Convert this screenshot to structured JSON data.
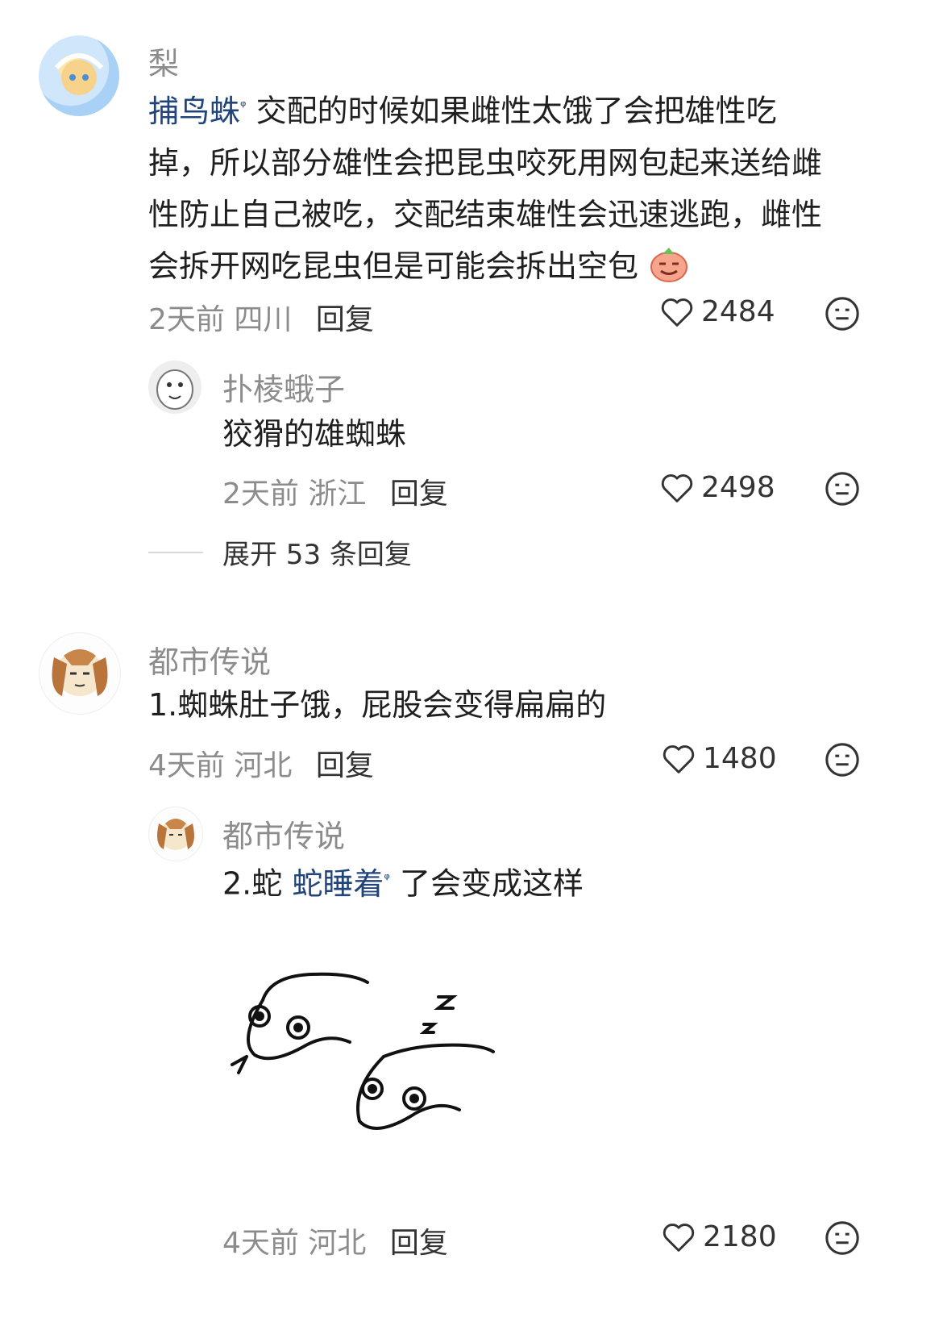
{
  "comments": [
    {
      "username": "梨",
      "link_text": "捕鸟蛛",
      "text_parts": [
        "交配的时候如果雌性太饿了会把雄性吃",
        "掉，所以部分雄性会把昆虫咬死用网包起来送给雌",
        "性防止自己被吃，交配结束雄性会迅速逃跑，雌性",
        "会拆开网吃昆虫但是可能会拆出空包"
      ],
      "time": "2天前",
      "location": "四川",
      "reply_label": "回复",
      "likes": "2484"
    },
    {
      "username": "扑棱蛾子",
      "text": "狡猾的雄蜘蛛",
      "time": "2天前",
      "location": "浙江",
      "reply_label": "回复",
      "likes": "2498"
    },
    {
      "username": "都市传说",
      "text": "1.蜘蛛肚子饿，屁股会变得扁扁的",
      "time": "4天前",
      "location": "河北",
      "reply_label": "回复",
      "likes": "1480"
    },
    {
      "username": "都市传说",
      "text_prefix": "2.蛇",
      "link_text": "蛇睡着",
      "text_suffix": "了会变成这样",
      "time": "4天前",
      "location": "河北",
      "reply_label": "回复",
      "likes": "2180"
    }
  ],
  "expand_replies": "展开 53 条回复",
  "icons": {
    "like": "heart-outline-icon",
    "dislike": "meh-face-icon",
    "search": "search-icon"
  },
  "colors": {
    "link": "#21447a",
    "meta": "#8c8c8c"
  }
}
